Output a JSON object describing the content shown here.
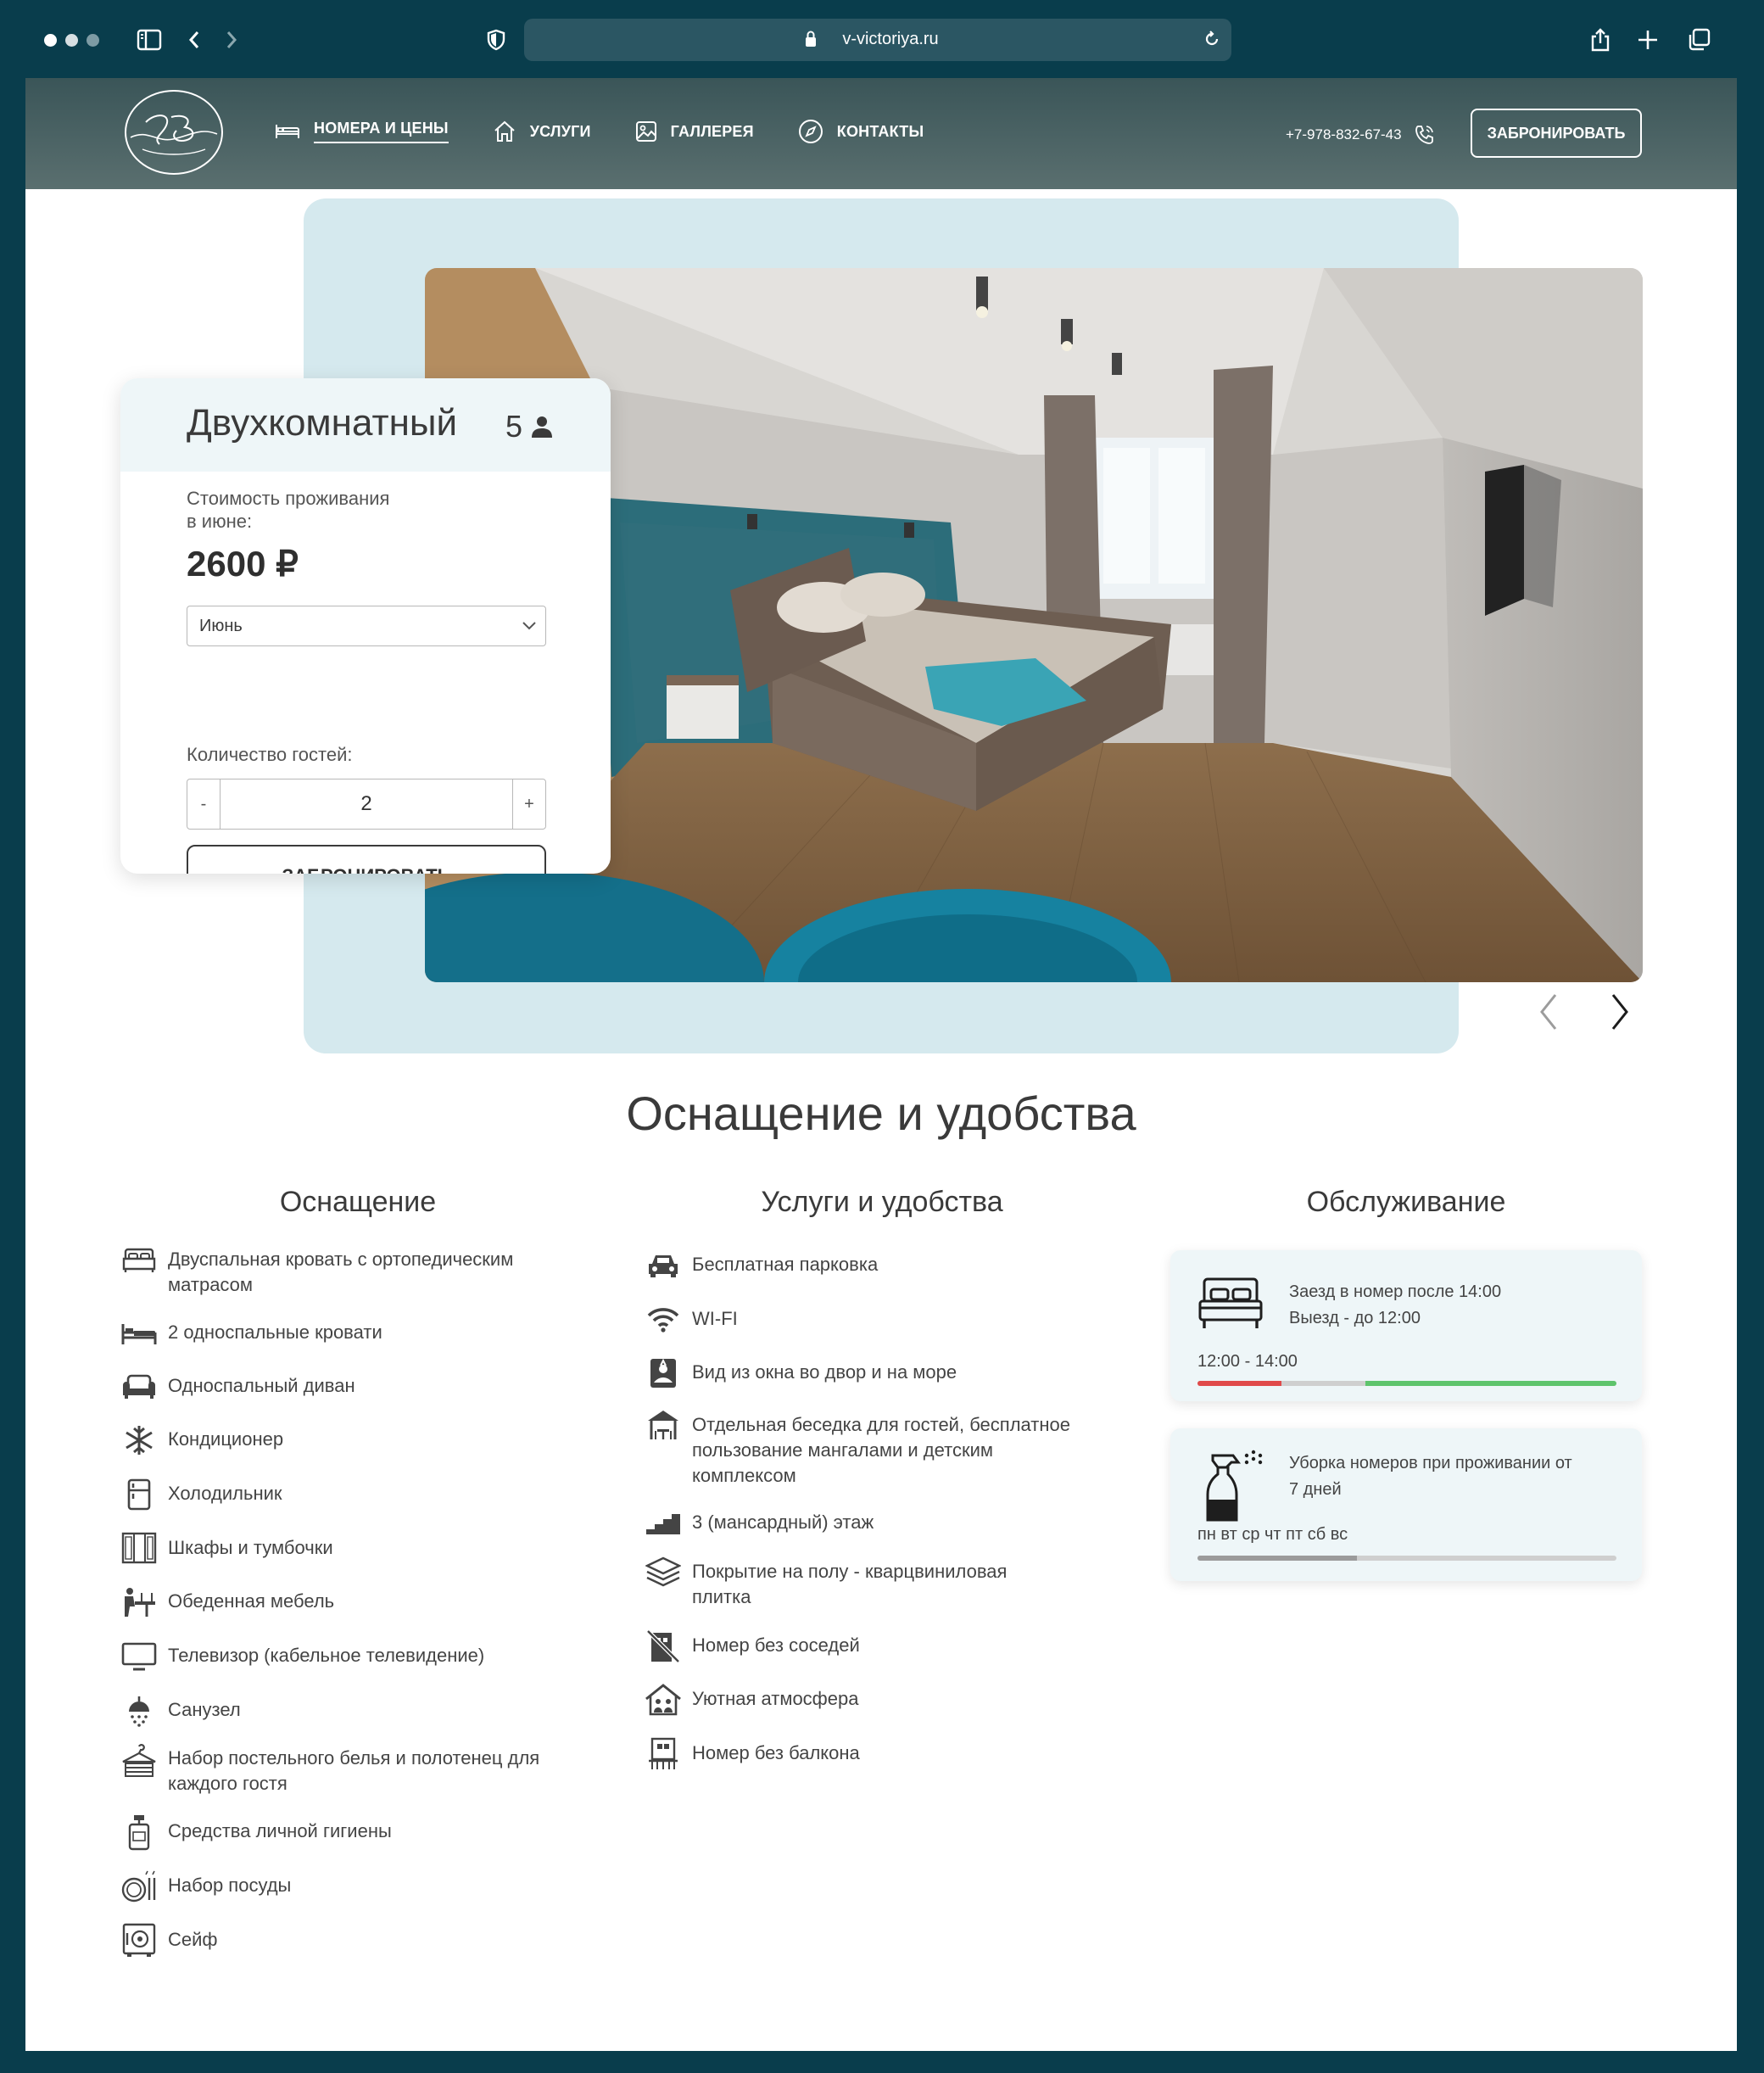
{
  "browser": {
    "url": "v-victoriya.ru"
  },
  "header": {
    "nav": [
      {
        "label": "НОМЕРА И ЦЕНЫ",
        "icon": "bed-icon",
        "active": true
      },
      {
        "label": "УСЛУГИ",
        "icon": "home-icon"
      },
      {
        "label": "ГАЛЛЕРЕЯ",
        "icon": "image-icon"
      },
      {
        "label": "КОНТАКТЫ",
        "icon": "compass-icon"
      }
    ],
    "phone": "+7-978-832-67-43",
    "book_label": "ЗАБРОНИРОВАТЬ"
  },
  "room": {
    "title": "Двухкомнатный",
    "capacity": "5",
    "price_label_line1": "Стоимость проживания",
    "price_label_line2": "в июне:",
    "price": "2600 ₽",
    "month": "Июнь",
    "guests_label": "Количество гостей:",
    "guests": "2",
    "minus": "-",
    "plus": "+",
    "book_label": "ЗАБРОНИРОВАТЬ"
  },
  "amenities": {
    "title": "Оснащение и удобства",
    "equipment": {
      "title": "Оснащение",
      "items": [
        {
          "line1": "Двуспальная кровать с ортопедическим",
          "line2": "матрасом",
          "icon": "double-bed-icon"
        },
        {
          "line1": "2 односпальные кровати",
          "line2": "",
          "icon": "single-bed-icon"
        },
        {
          "line1": "Односпальный диван",
          "line2": "",
          "icon": "sofa-icon"
        },
        {
          "line1": "Кондиционер",
          "line2": "",
          "icon": "snowflake-icon"
        },
        {
          "line1": "Холодильник",
          "line2": "",
          "icon": "fridge-icon"
        },
        {
          "line1": "Шкафы и тумбочки",
          "line2": "",
          "icon": "wardrobe-icon"
        },
        {
          "line1": "Обеденная мебель",
          "line2": "",
          "icon": "dining-icon"
        },
        {
          "line1": "Телевизор (кабельное телевидение)",
          "line2": "",
          "icon": "tv-icon"
        },
        {
          "line1": "Санузел",
          "line2": "",
          "icon": "shower-icon"
        },
        {
          "line1": "Набор постельного белья и полотенец для",
          "line2": "каждого гостя",
          "icon": "linen-icon"
        },
        {
          "line1": "Средства личной гигиены",
          "line2": "",
          "icon": "hygiene-icon"
        },
        {
          "line1": "Набор посуды",
          "line2": "",
          "icon": "dishes-icon"
        },
        {
          "line1": "Сейф",
          "line2": "",
          "icon": "safe-icon"
        }
      ]
    },
    "services": {
      "title": "Услуги и удобства",
      "items": [
        {
          "line1": "Бесплатная парковка",
          "line2": "",
          "line3": "",
          "icon": "car-icon"
        },
        {
          "line1": "WI-FI",
          "line2": "",
          "line3": "",
          "icon": "wifi-icon"
        },
        {
          "line1": "Вид из окна во двор и на море",
          "line2": "",
          "line3": "",
          "icon": "view-icon"
        },
        {
          "line1": "Отдельная беседка для гостей, бесплатное",
          "line2": "пользование мангалами и детским",
          "line3": "комплексом",
          "icon": "gazebo-icon"
        },
        {
          "line1": "3 (мансардный) этаж",
          "line2": "",
          "line3": "",
          "icon": "stairs-icon"
        },
        {
          "line1": "Покрытие на полу - кварцвиниловая",
          "line2": "плитка",
          "line3": "",
          "icon": "layers-icon"
        },
        {
          "line1": "Номер без соседей",
          "line2": "",
          "line3": "",
          "icon": "no-neighbors-icon"
        },
        {
          "line1": "Уютная атмосфера",
          "line2": "",
          "line3": "",
          "icon": "cozy-home-icon"
        },
        {
          "line1": "Номер без балкона",
          "line2": "",
          "line3": "",
          "icon": "no-balcony-icon"
        }
      ]
    },
    "maintenance": {
      "title": "Обслуживание",
      "checkin_line1": "Заезд в номер после 14:00",
      "checkin_line2": "Выезд - до 12:00",
      "checkin_times": "12:00 - 14:00",
      "checkin_bar": {
        "red": 0.2,
        "gap": 0.2,
        "green": 0.6
      },
      "cleaning_line1": "Уборка номеров при проживании от",
      "cleaning_line2": "7 дней",
      "cleaning_days": "пн вт ср чт пт сб вс",
      "cleaning_bar": {
        "filled": 0.38
      }
    }
  },
  "colors": {
    "frame": "#093d4c",
    "header": "#4a6262",
    "hero_bg": "#d5e9ee",
    "card_head": "#eef6f8",
    "bar_red": "#e04a4a",
    "bar_green": "#5ec46c"
  }
}
